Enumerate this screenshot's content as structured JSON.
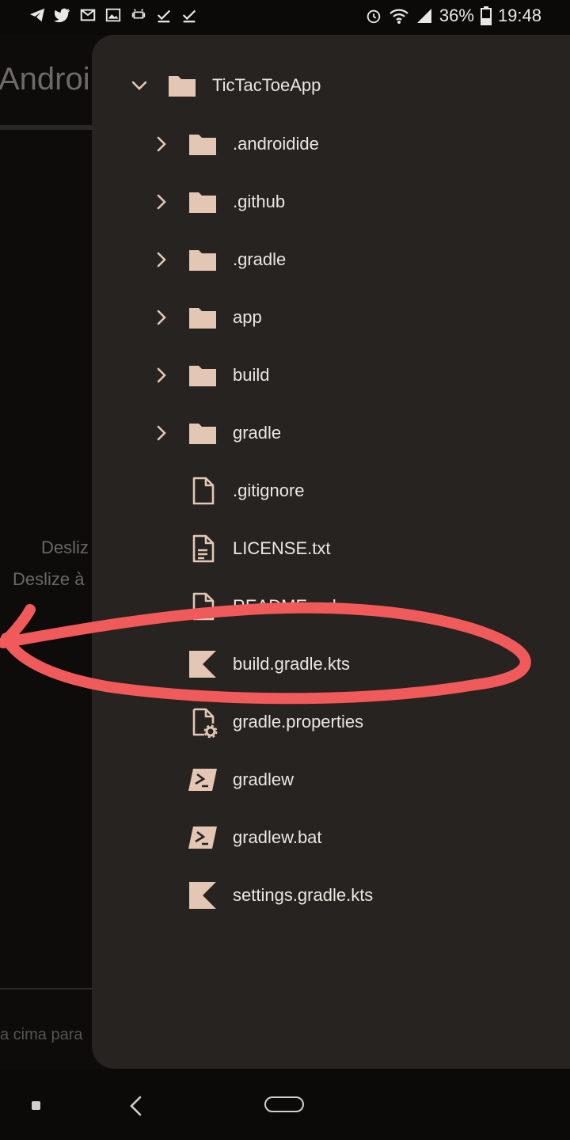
{
  "status_bar": {
    "notification_icons": [
      "telegram-icon",
      "twitter-icon",
      "gmail-icon",
      "gallery-icon",
      "android-debug-icon",
      "check-icon",
      "check-icon"
    ],
    "battery": "36%",
    "time": "19:48"
  },
  "background_app": {
    "title": "Androi",
    "hint_line1": "Desliz",
    "hint_line2": "Deslize à",
    "footer_hint": "a cima para"
  },
  "file_tree": {
    "root": {
      "name": "TicTacToeApp",
      "expanded": true
    },
    "items": [
      {
        "name": ".androidide",
        "type": "folder"
      },
      {
        "name": ".github",
        "type": "folder"
      },
      {
        "name": ".gradle",
        "type": "folder"
      },
      {
        "name": "app",
        "type": "folder"
      },
      {
        "name": "build",
        "type": "folder"
      },
      {
        "name": "gradle",
        "type": "folder"
      },
      {
        "name": ".gitignore",
        "type": "file"
      },
      {
        "name": "LICENSE.txt",
        "type": "text-file"
      },
      {
        "name": "README.md",
        "type": "file"
      },
      {
        "name": "build.gradle.kts",
        "type": "kotlin"
      },
      {
        "name": "gradle.properties",
        "type": "settings-file"
      },
      {
        "name": "gradlew",
        "type": "terminal"
      },
      {
        "name": "gradlew.bat",
        "type": "terminal"
      },
      {
        "name": "settings.gradle.kts",
        "type": "kotlin"
      }
    ]
  },
  "colors": {
    "drawer_bg": "#262321",
    "icon": "#e3c7b4",
    "text": "#ece6e0",
    "annotation": "#f05a5a"
  }
}
